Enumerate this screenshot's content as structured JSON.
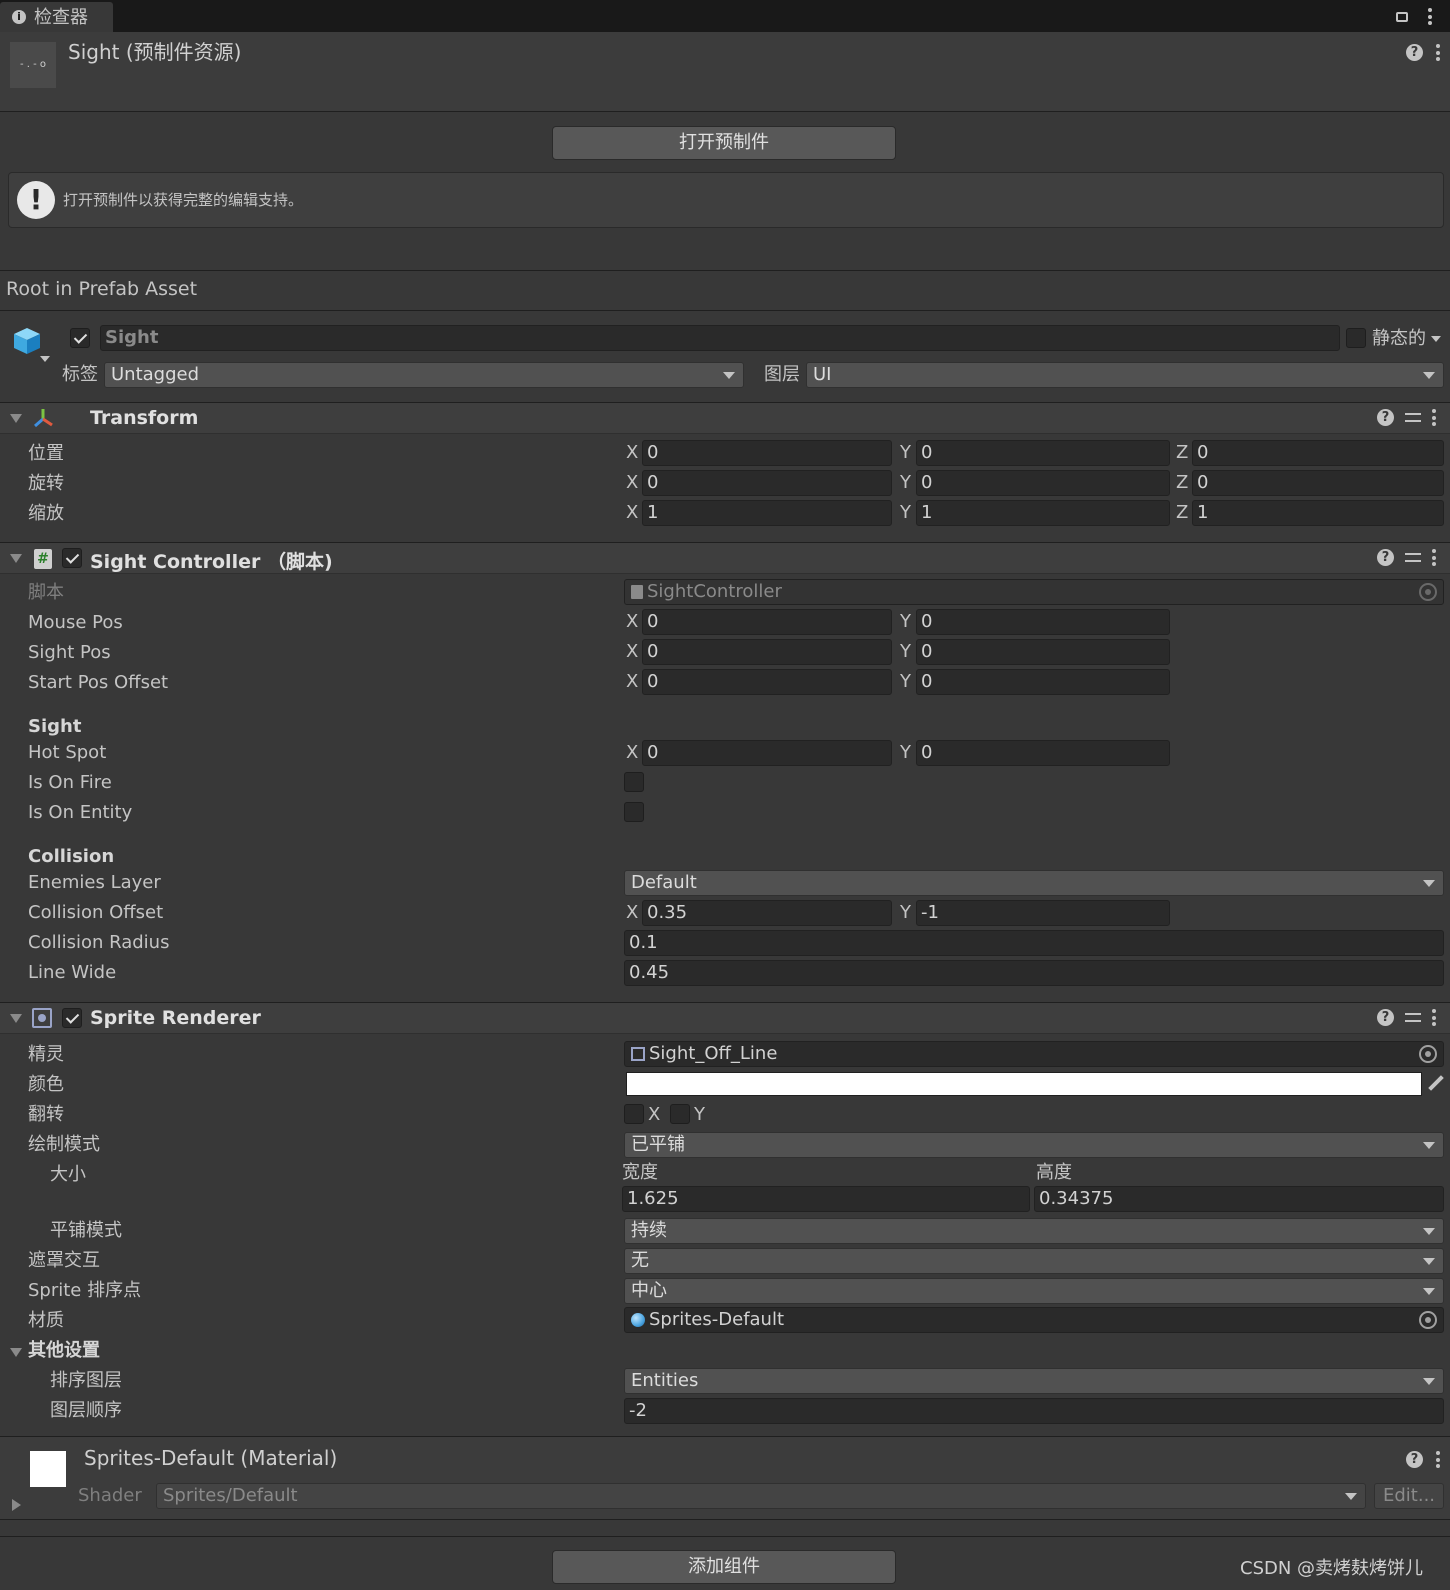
{
  "tab": {
    "title": "检查器"
  },
  "asset": {
    "title": "Sight (预制件资源)",
    "thumb_text": "- . - o"
  },
  "open_prefab_button": "打开预制件",
  "help_box": "打开预制件以获得完整的编辑支持。",
  "root_label": "Root in Prefab Asset",
  "gameobject": {
    "name": "Sight",
    "active": true,
    "static_label": "静态的",
    "tag_label": "标签",
    "tag_value": "Untagged",
    "layer_label": "图层",
    "layer_value": "UI"
  },
  "transform": {
    "title": "Transform",
    "rows": [
      {
        "label": "位置",
        "x": "0",
        "y": "0",
        "z": "0"
      },
      {
        "label": "旋转",
        "x": "0",
        "y": "0",
        "z": "0"
      },
      {
        "label": "缩放",
        "x": "1",
        "y": "1",
        "z": "1"
      }
    ]
  },
  "axes": {
    "x": "X",
    "y": "Y",
    "z": "Z"
  },
  "sight_controller": {
    "title": "Sight Controller （脚本)",
    "script_label": "脚本",
    "script_value": "SightController",
    "mouse_pos": {
      "label": "Mouse Pos",
      "x": "0",
      "y": "0"
    },
    "sight_pos": {
      "label": "Sight Pos",
      "x": "0",
      "y": "0"
    },
    "start_pos_offset": {
      "label": "Start Pos Offset",
      "x": "0",
      "y": "0"
    },
    "sight_header": "Sight",
    "hot_spot": {
      "label": "Hot Spot",
      "x": "0",
      "y": "0"
    },
    "is_on_fire": {
      "label": "Is On Fire",
      "checked": false
    },
    "is_on_entity": {
      "label": "Is On Entity",
      "checked": false
    },
    "collision_header": "Collision",
    "enemies_layer": {
      "label": "Enemies Layer",
      "value": "Default"
    },
    "collision_offset": {
      "label": "Collision Offset",
      "x": "0.35",
      "y": "-1"
    },
    "collision_radius": {
      "label": "Collision Radius",
      "value": "0.1"
    },
    "line_wide": {
      "label": "Line Wide",
      "value": "0.45"
    }
  },
  "sprite_renderer": {
    "title": "Sprite Renderer",
    "sprite": {
      "label": "精灵",
      "value": "Sight_Off_Line"
    },
    "color": {
      "label": "颜色",
      "value": "#ffffff"
    },
    "flip": {
      "label": "翻转",
      "x": "X",
      "y": "Y"
    },
    "draw_mode": {
      "label": "绘制模式",
      "value": "已平铺"
    },
    "size": {
      "label": "大小",
      "width_label": "宽度",
      "height_label": "高度",
      "width": "1.625",
      "height": "0.34375"
    },
    "tile_mode": {
      "label": "平铺模式",
      "value": "持续"
    },
    "mask_interaction": {
      "label": "遮罩交互",
      "value": "无"
    },
    "sort_point": {
      "label": "Sprite 排序点",
      "value": "中心"
    },
    "material": {
      "label": "材质",
      "value": "Sprites-Default"
    },
    "other_settings": "其他设置",
    "sorting_layer": {
      "label": "排序图层",
      "value": "Entities"
    },
    "order_in_layer": {
      "label": "图层顺序",
      "value": "-2"
    }
  },
  "material_section": {
    "title": "Sprites-Default (Material)",
    "shader_label": "Shader",
    "shader_value": "Sprites/Default",
    "edit_button": "Edit..."
  },
  "add_component_button": "添加组件",
  "watermark": "CSDN @卖烤麸烤饼儿",
  "colors": {
    "accent_blue": "#4aa3df",
    "panel": "#383838",
    "field": "#2a2a2a"
  }
}
